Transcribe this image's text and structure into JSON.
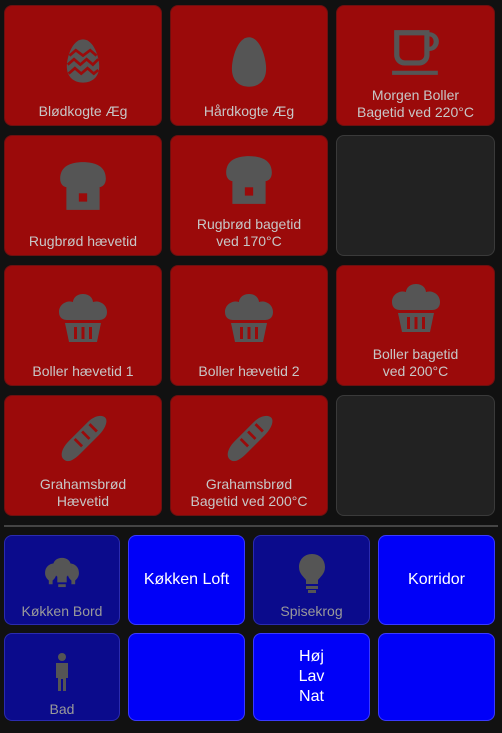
{
  "colors": {
    "tile_red": "#9b0a0a",
    "tile_empty": "#222222",
    "tile_navy": "#0b0b8c",
    "tile_blue": "#0000f8",
    "icon_gray": "#555555",
    "background": "#111111"
  },
  "timers": [
    {
      "label": "Blødkogte Æg",
      "icon": "egg-patterned-icon"
    },
    {
      "label": "Hårdkogte Æg",
      "icon": "egg-icon"
    },
    {
      "label": "Morgen Boller\nBagetid ved 220°C",
      "icon": "coffee-cup-icon"
    },
    {
      "label": "Rugbrød hævetid",
      "icon": "bread-loaf-icon"
    },
    {
      "label": "Rugbrød bagetid\nved 170°C",
      "icon": "bread-loaf-icon"
    },
    {
      "label": "Boller hævetid 1",
      "icon": "muffin-icon"
    },
    {
      "label": "Boller hævetid 2",
      "icon": "muffin-icon"
    },
    {
      "label": "Boller bagetid\nved 200°C",
      "icon": "muffin-icon"
    },
    {
      "label": "Grahamsbrød\nHævetid",
      "icon": "baguette-icon"
    },
    {
      "label": "Grahamsbrød\nBagetid ved 200°C",
      "icon": "baguette-icon"
    }
  ],
  "lights": [
    {
      "label": "Køkken Bord",
      "icon": "ceiling-lights-icon"
    },
    {
      "label": "Køkken Loft"
    },
    {
      "label": "Spisekrog",
      "icon": "lightbulb-icon"
    },
    {
      "label": "Korridor"
    },
    {
      "label": "Bad",
      "icon": "person-icon"
    },
    {
      "label": ""
    },
    {
      "label": "Høj\nLav\nNat"
    },
    {
      "label": ""
    }
  ]
}
